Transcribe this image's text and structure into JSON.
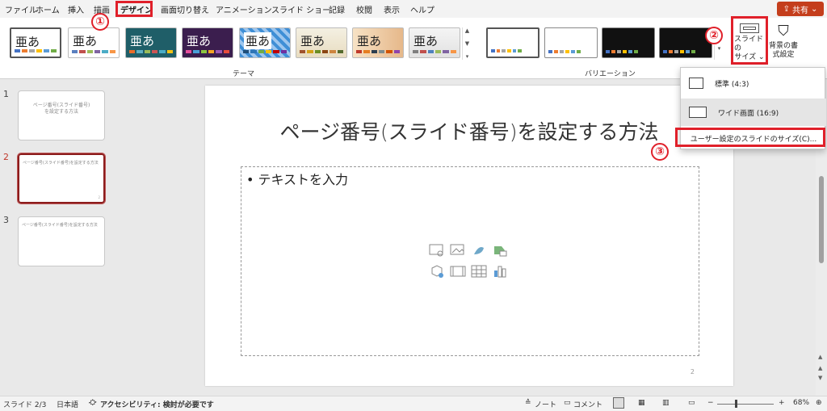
{
  "menu": {
    "tabs": [
      "ファイル",
      "ホーム",
      "挿入",
      "描画",
      "デザイン",
      "画面切り替え",
      "アニメーション",
      "スライド ショー",
      "記録",
      "校閲",
      "表示",
      "ヘルプ"
    ],
    "share_label": "共有"
  },
  "callouts": {
    "one": "①",
    "two": "②",
    "three": "③"
  },
  "ribbon": {
    "theme_glyph": "亜あ",
    "themes_label": "テーマ",
    "variations_label": "バリエーション",
    "slide_size_label_1": "スライドの",
    "slide_size_label_2": "サイズ ⌄",
    "format_bg_label_1": "背景の書",
    "format_bg_label_2": "式設定"
  },
  "dropdown": {
    "items": [
      "標準 (4:3)",
      "ワイド画面 (16:9)",
      "ユーザー設定のスライドのサイズ(C)..."
    ]
  },
  "thumbnails": [
    {
      "num": "1",
      "text": "ページ番号(スライド番号)\nを設定する方法"
    },
    {
      "num": "2",
      "text": "ページ番号(スライド番号)を設定する方法"
    },
    {
      "num": "3",
      "text": "ページ番号(スライド番号)を設定する方法"
    }
  ],
  "slide": {
    "title": "ページ番号(スライド番号)を設定する方法",
    "bullet": "• テキストを入力",
    "number": "2"
  },
  "status": {
    "slide_pos": "スライド 2/3",
    "language": "日本語",
    "accessibility": "アクセシビリティ: 検討が必要です",
    "notes": "ノート",
    "comments": "コメント",
    "zoom": "68%"
  },
  "colors": {
    "accent_red": "#e0202a",
    "share_bg": "#c43e1c",
    "selected_thumb": "#8c1d1d"
  }
}
